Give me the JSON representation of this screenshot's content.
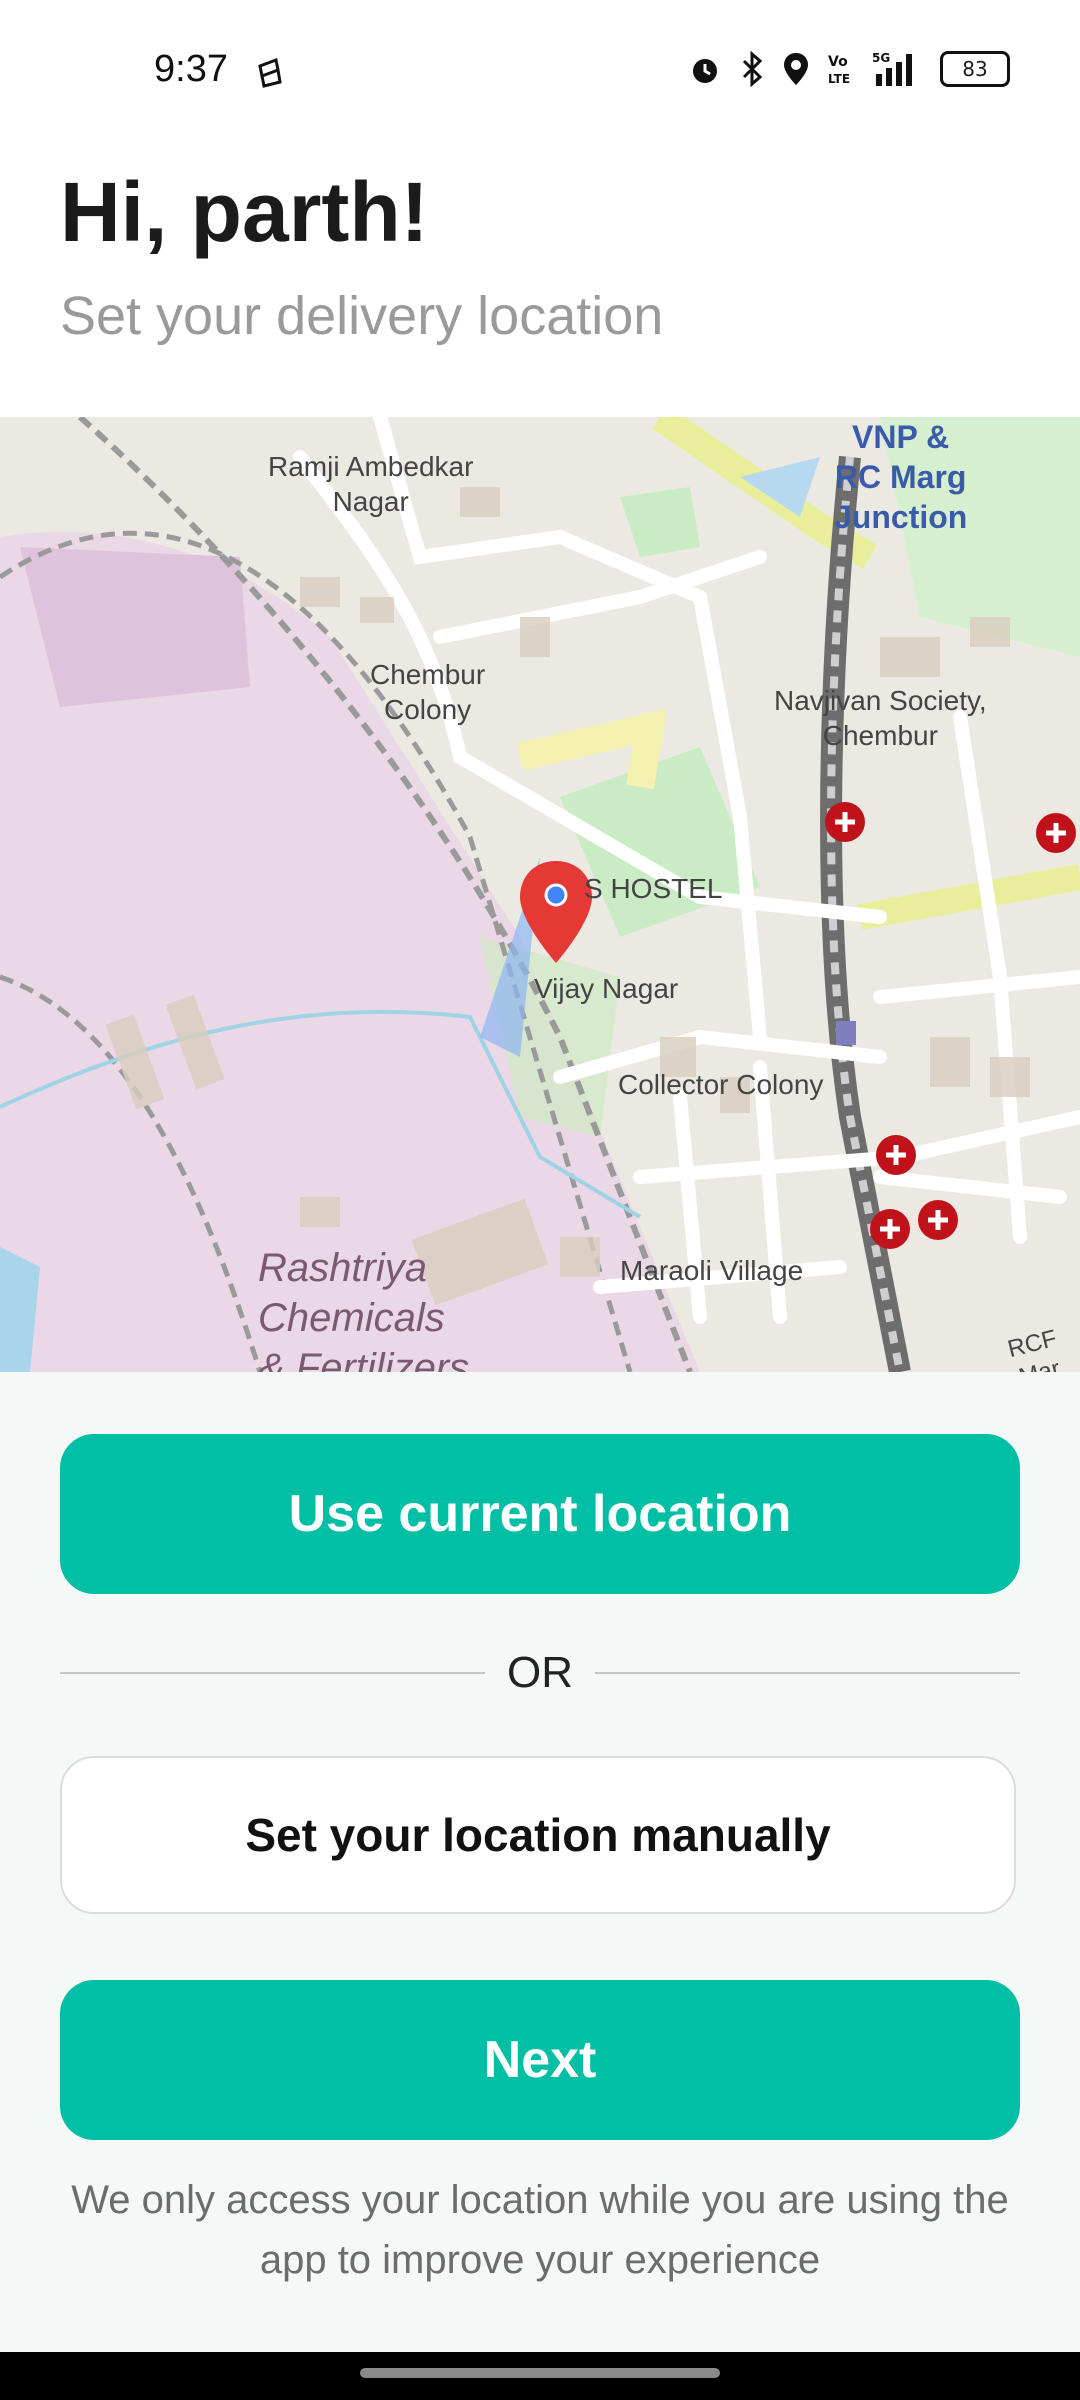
{
  "status_bar": {
    "time": "9:37",
    "battery_level": "83",
    "icons": [
      "sync-icon",
      "alarm-icon",
      "bluetooth-icon",
      "location-icon",
      "volte-icon",
      "signal-5g-icon",
      "battery-icon"
    ]
  },
  "header": {
    "greeting": "Hi, parth!",
    "subtitle": "Set your delivery location"
  },
  "map": {
    "labels": {
      "ramji": "Ramji Ambedkar\nNagar",
      "vnp": "VNP &\nRC Marg\nJunction",
      "chembur_colony": "Chembur\nColony",
      "navjivan": "Navjivan Society,\nChembur",
      "hostel": "S HOSTEL",
      "vijay": "Vijay Nagar",
      "collector": "Collector Colony",
      "maraoli": "Maraoli Village",
      "rashtriya": "Rashtriya\nChemicals\n& Fertilizers",
      "rcf": "RCF Mar"
    },
    "marker_icon": "location-pin-icon",
    "hospital_icon": "hospital-icon"
  },
  "actions": {
    "use_current": "Use current location",
    "or": "OR",
    "manual": "Set your location manually",
    "next": "Next"
  },
  "note": "We only access your location while you are using the app to improve your experience",
  "colors": {
    "accent": "#00bfa5",
    "pin": "#e53935",
    "industrial": "#ead8e6"
  }
}
